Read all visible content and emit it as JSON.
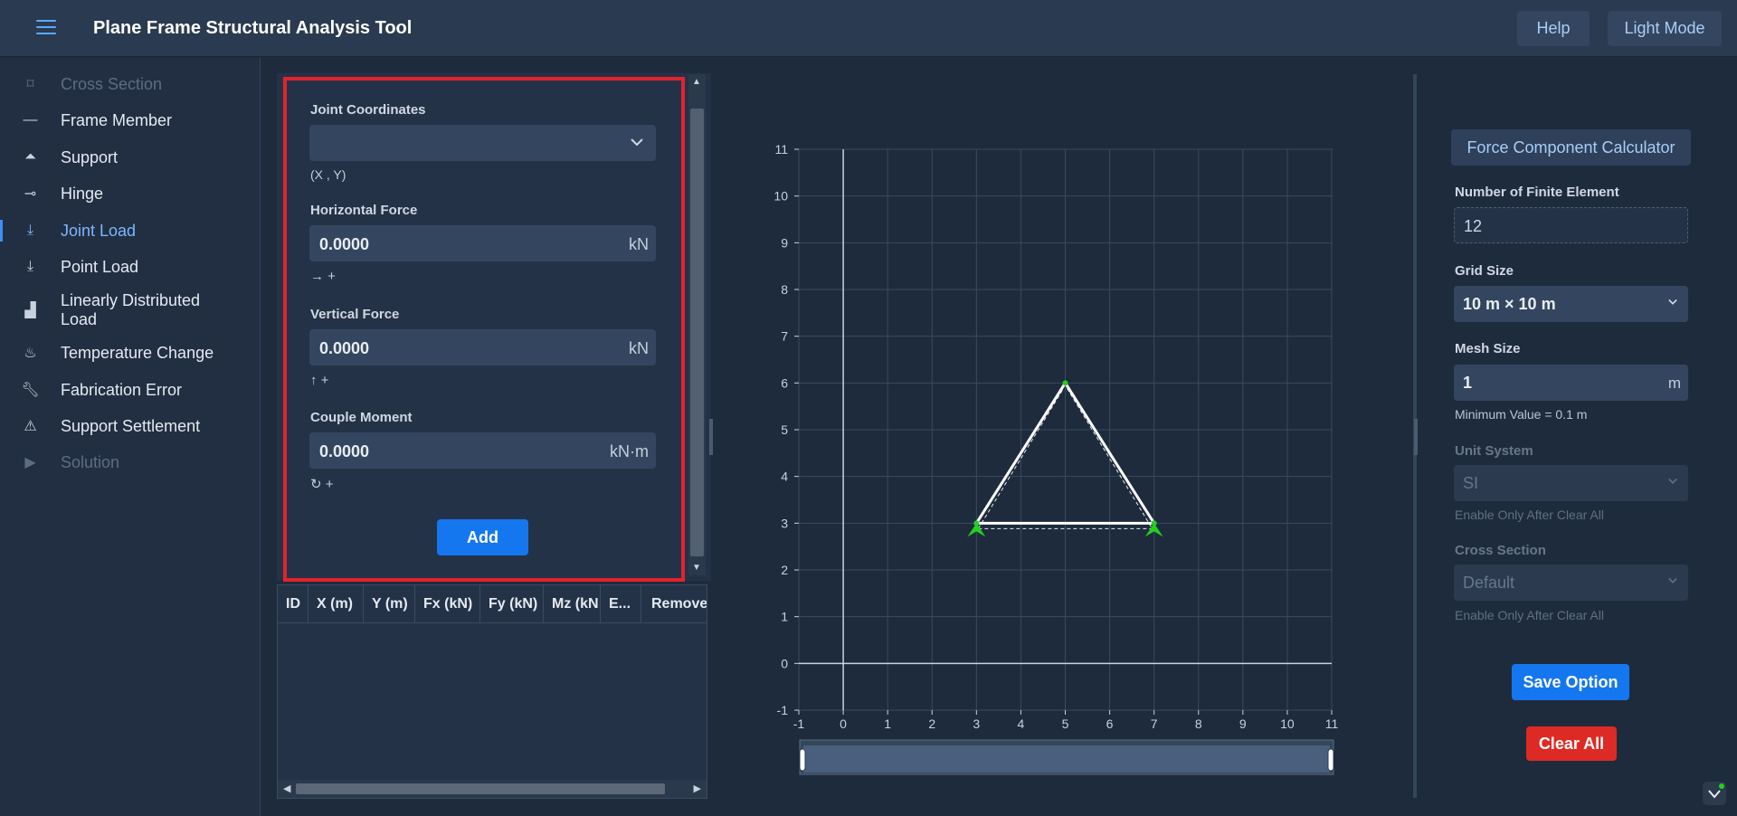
{
  "header": {
    "title": "Plane Frame Structural Analysis Tool",
    "help_label": "Help",
    "mode_label": "Light Mode"
  },
  "sidebar": {
    "items": [
      {
        "label": "Cross Section",
        "icon": "cross-section-icon",
        "state": "disabled"
      },
      {
        "label": "Frame Member",
        "icon": "frame-member-icon",
        "state": "normal"
      },
      {
        "label": "Support",
        "icon": "support-icon",
        "state": "normal"
      },
      {
        "label": "Hinge",
        "icon": "hinge-icon",
        "state": "normal"
      },
      {
        "label": "Joint Load",
        "icon": "joint-load-icon",
        "state": "active"
      },
      {
        "label": "Point Load",
        "icon": "point-load-icon",
        "state": "normal"
      },
      {
        "label": "Linearly Distributed Load",
        "icon": "distributed-load-icon",
        "state": "normal"
      },
      {
        "label": "Temperature Change",
        "icon": "temperature-icon",
        "state": "normal"
      },
      {
        "label": "Fabrication Error",
        "icon": "wrench-icon",
        "state": "normal"
      },
      {
        "label": "Support Settlement",
        "icon": "warning-icon",
        "state": "normal"
      },
      {
        "label": "Solution",
        "icon": "play-icon",
        "state": "disabled"
      }
    ]
  },
  "form": {
    "joint_label": "Joint Coordinates",
    "joint_value": "",
    "joint_hint": "(X , Y)",
    "h_force_label": "Horizontal Force",
    "h_force_value": "0.0000",
    "h_force_unit": "kN",
    "h_force_hint": "→ +",
    "v_force_label": "Vertical Force",
    "v_force_value": "0.0000",
    "v_force_unit": "kN",
    "v_force_hint": "↑ +",
    "moment_label": "Couple Moment",
    "moment_value": "0.0000",
    "moment_unit": "kN·m",
    "moment_hint": "↻ +",
    "add_label": "Add"
  },
  "table": {
    "columns": [
      "ID",
      "X (m)",
      "Y (m)",
      "Fx (kN)",
      "Fy (kN)",
      "Mz (kN",
      "E...",
      "Remove"
    ],
    "rows": []
  },
  "chart_data": {
    "type": "scatter",
    "title": "",
    "xlabel": "",
    "ylabel": "",
    "xlim": [
      -1,
      11
    ],
    "ylim": [
      -1,
      11
    ],
    "x_ticks": [
      "-1",
      "0",
      "1",
      "2",
      "3",
      "4",
      "5",
      "6",
      "7",
      "8",
      "9",
      "10",
      "11"
    ],
    "y_ticks": [
      "-1",
      "0",
      "1",
      "2",
      "3",
      "4",
      "5",
      "6",
      "7",
      "8",
      "9",
      "10",
      "11"
    ],
    "grid": true,
    "joints": [
      {
        "x": 3,
        "y": 3
      },
      {
        "x": 5,
        "y": 6
      },
      {
        "x": 7,
        "y": 3
      }
    ],
    "members": [
      {
        "from": [
          3,
          3
        ],
        "to": [
          5,
          6
        ]
      },
      {
        "from": [
          5,
          6
        ],
        "to": [
          7,
          3
        ]
      },
      {
        "from": [
          3,
          3
        ],
        "to": [
          7,
          3
        ]
      }
    ],
    "supports": [
      {
        "x": 3,
        "y": 3,
        "type": "pin"
      },
      {
        "x": 7,
        "y": 3,
        "type": "pin"
      }
    ],
    "colors": {
      "member": "#ffffff",
      "support": "#22d11f",
      "grid": "#3b4a5e",
      "axis": "#c9d2dc"
    }
  },
  "settings": {
    "calculator_label": "Force Component Calculator",
    "finite_label": "Number of Finite Element",
    "finite_value": "12",
    "grid_label": "Grid Size",
    "grid_value": "10 m × 10 m",
    "mesh_label": "Mesh Size",
    "mesh_value": "1",
    "mesh_unit": "m",
    "mesh_note": "Minimum Value = 0.1 m",
    "unit_label": "Unit System",
    "unit_value": "SI",
    "unit_note": "Enable Only After Clear All",
    "cross_label": "Cross Section",
    "cross_value": "Default",
    "cross_note": "Enable Only After Clear All",
    "save_label": "Save Option",
    "clear_label": "Clear All"
  }
}
